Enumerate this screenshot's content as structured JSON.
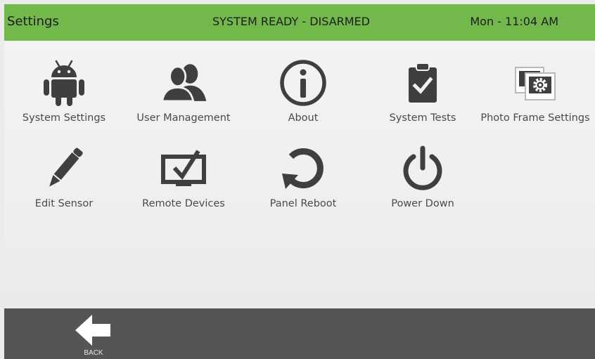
{
  "header": {
    "title": "Settings",
    "status": "SYSTEM READY - DISARMED",
    "clock": "Mon - 11:04 AM"
  },
  "tiles": [
    {
      "label": "System Settings",
      "icon": "android-icon"
    },
    {
      "label": "User Management",
      "icon": "users-icon"
    },
    {
      "label": "About",
      "icon": "info-icon"
    },
    {
      "label": "System Tests",
      "icon": "clipboard-check-icon"
    },
    {
      "label": "Photo Frame Settings",
      "icon": "photo-frame-gear-icon"
    },
    {
      "label": "Edit Sensor",
      "icon": "pencil-icon"
    },
    {
      "label": "Remote Devices",
      "icon": "remote-monitor-icon"
    },
    {
      "label": "Panel Reboot",
      "icon": "reboot-icon"
    },
    {
      "label": "Power Down",
      "icon": "power-icon"
    }
  ],
  "footer": {
    "back_label": "BACK"
  },
  "colors": {
    "header_bg": "#72b84a",
    "footer_bg": "#555555",
    "icon_color": "#3f3f3f"
  }
}
